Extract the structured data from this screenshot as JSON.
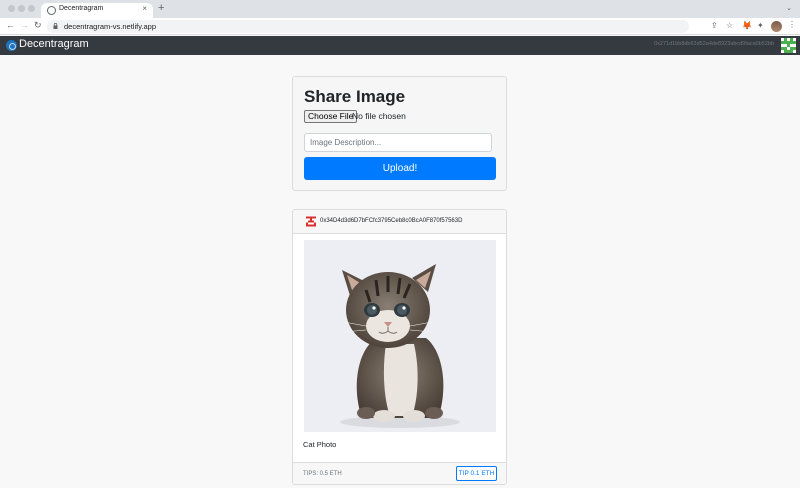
{
  "browser": {
    "tab_title": "Decentragram",
    "tab_close": "×",
    "new_tab": "+",
    "tab_menu": "⌄",
    "url": "decentragram-vs.netlify.app",
    "nav_back": "←",
    "nav_forward": "→",
    "nav_reload": "↻",
    "share_icon": "⇪",
    "star_icon": "☆",
    "metamask_icon": "🦊",
    "extensions_icon": "✦",
    "menu_icon": "⋮"
  },
  "navbar": {
    "brand": "Decentragram",
    "account": "0x271d1bb8db63d52a4de8923abcd9faca0b52bb"
  },
  "upload_form": {
    "title": "Share Image",
    "choose_file_label": "Choose File",
    "file_status": "No file chosen",
    "description_placeholder": "Image Description...",
    "submit_label": "Upload!"
  },
  "posts": [
    {
      "author": "0x34D4d3d6D7bFCfc3795Ceb8c0BcA0F870f57563D",
      "description": "Cat Photo",
      "tips": "TIPS: 0.5 ETH",
      "tip_button": "TIP 0.1 ETH"
    }
  ],
  "colors": {
    "navbar_bg": "#343a40",
    "primary": "#007bff"
  }
}
